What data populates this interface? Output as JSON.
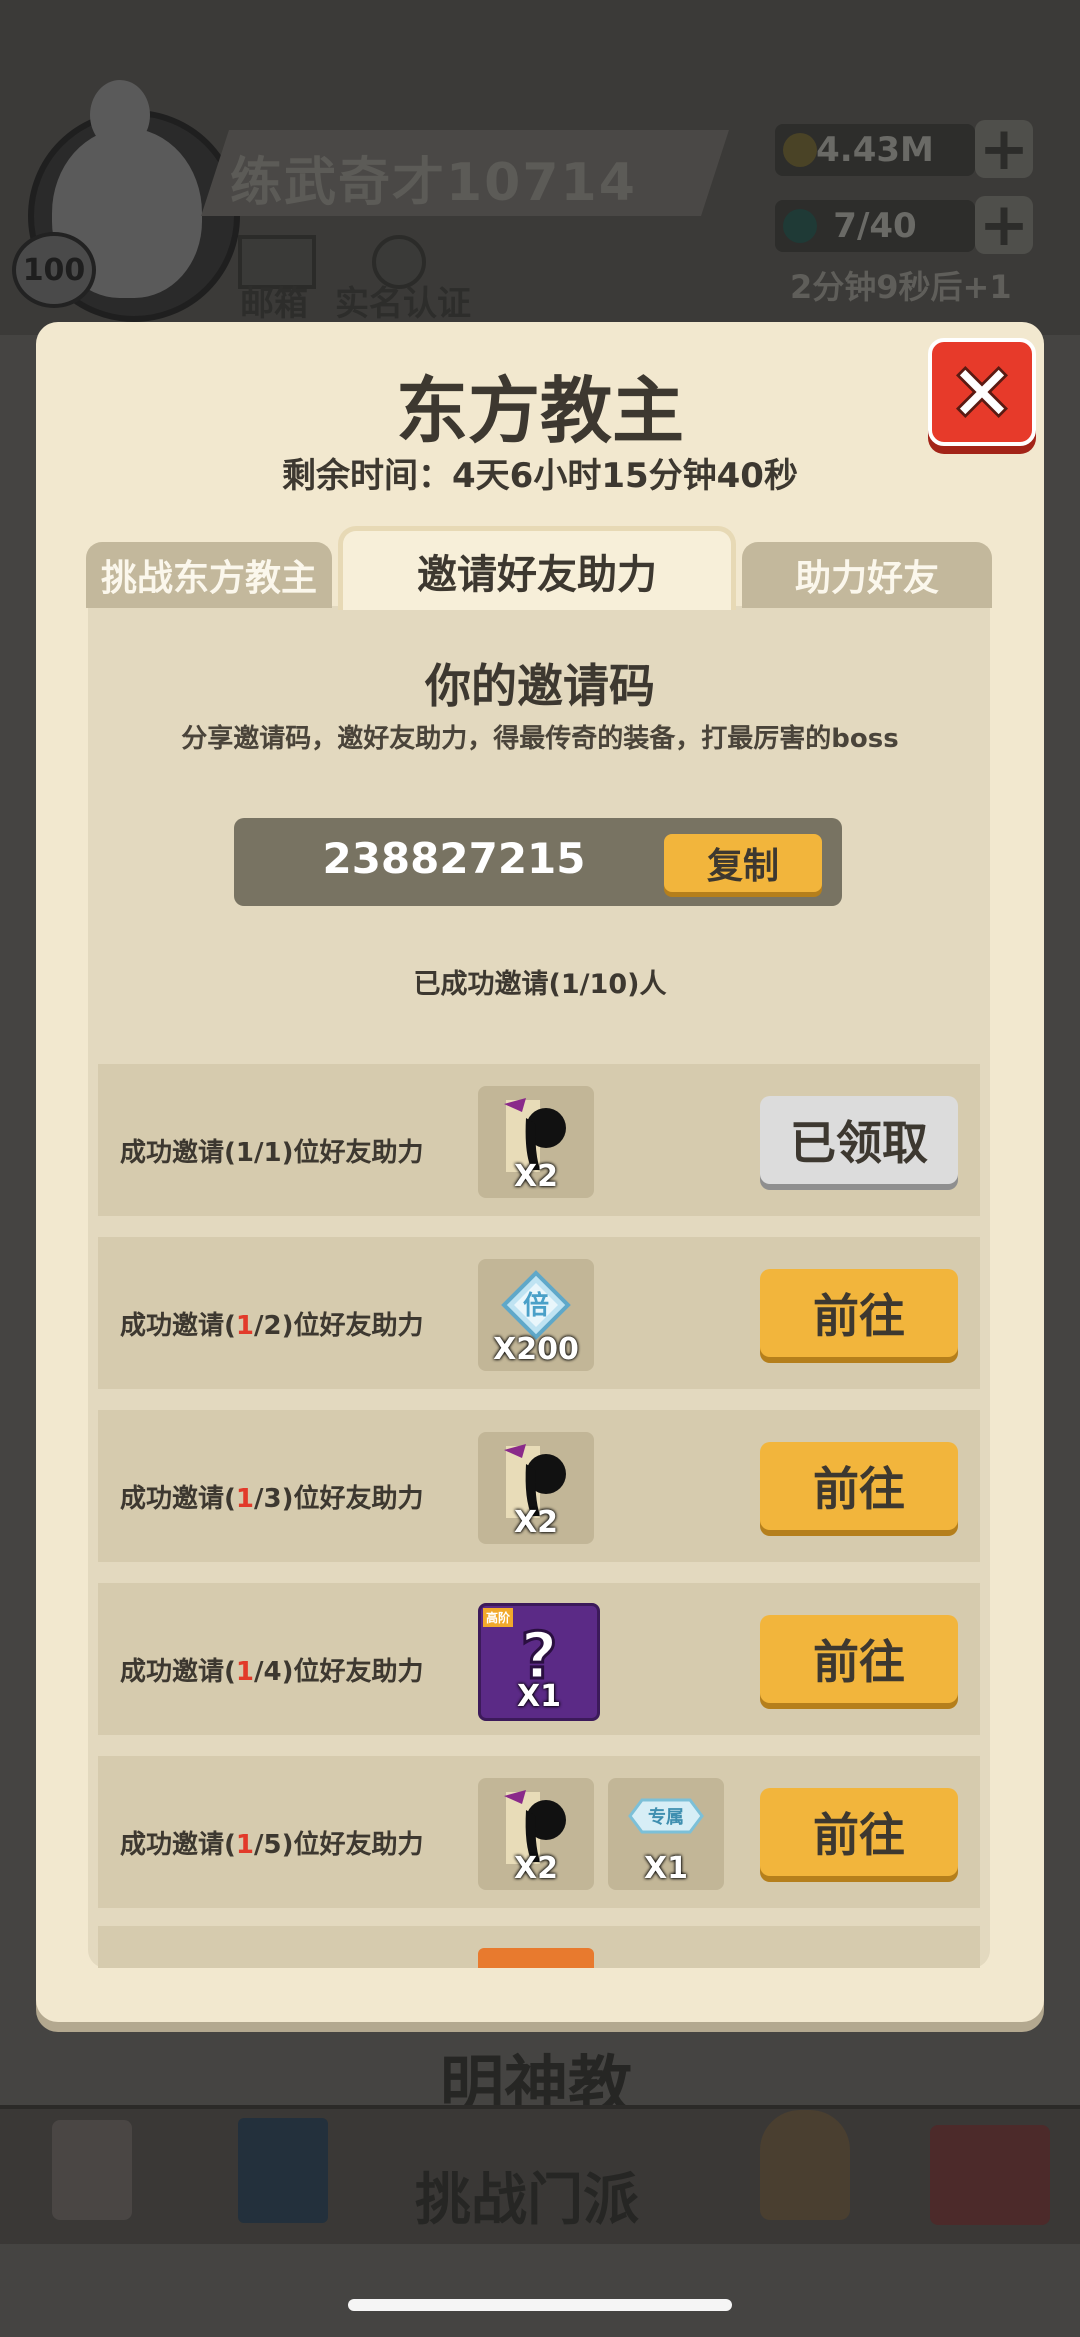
{
  "background": {
    "player_name": "练武奇才10714",
    "level": "100",
    "gold": "4.43M",
    "energy": "7/40",
    "energy_timer": "2分钟9秒后+1",
    "mail_label": "邮箱",
    "realname_label": "实名认证",
    "section_label": "明神教",
    "nav": {
      "main_label": "挑战门派"
    }
  },
  "modal": {
    "title": "东方教主",
    "countdown": "剩余时间：4天6小时15分钟40秒",
    "tabs": [
      {
        "label": "挑战东方教主"
      },
      {
        "label": "邀请好友助力"
      },
      {
        "label": "助力好友"
      }
    ],
    "invite": {
      "heading": "你的邀请码",
      "description": "分享邀请码，邀好友助力，得最传奇的装备，打最厉害的boss",
      "code": "238827215",
      "copy_label": "复制",
      "invited_count": "已成功邀请(1/10)人"
    },
    "rows": [
      {
        "label_prefix": "成功邀请(",
        "progress": "1",
        "label_suffix": "/1)位好友助力",
        "progress_highlight": false,
        "rewards": [
          {
            "icon": "ninja-character-icon",
            "qty": "X2"
          }
        ],
        "button": "已领取",
        "button_state": "claimed"
      },
      {
        "label_prefix": "成功邀请(",
        "progress": "1",
        "label_suffix": "/2)位好友助力",
        "progress_highlight": true,
        "rewards": [
          {
            "icon": "diamond-multiplier-icon",
            "qty": "X200"
          }
        ],
        "button": "前往",
        "button_state": "go"
      },
      {
        "label_prefix": "成功邀请(",
        "progress": "1",
        "label_suffix": "/3)位好友助力",
        "progress_highlight": true,
        "rewards": [
          {
            "icon": "ninja-character-icon",
            "qty": "X2"
          }
        ],
        "button": "前往",
        "button_state": "go"
      },
      {
        "label_prefix": "成功邀请(",
        "progress": "1",
        "label_suffix": "/4)位好友助力",
        "progress_highlight": true,
        "rewards": [
          {
            "icon": "mystery-box-icon",
            "qty": "X1",
            "tag": "高阶"
          }
        ],
        "button": "前往",
        "button_state": "go"
      },
      {
        "label_prefix": "成功邀请(",
        "progress": "1",
        "label_suffix": "/5)位好友助力",
        "progress_highlight": true,
        "rewards": [
          {
            "icon": "ninja-character-icon",
            "qty": "X2"
          },
          {
            "icon": "exclusive-badge-icon",
            "qty": "X1",
            "badge_text": "专属"
          }
        ],
        "button": "前往",
        "button_state": "go"
      }
    ]
  },
  "colors": {
    "modal_bg": "#f2e8cf",
    "panel_bg": "#e3d9bf",
    "row_bg": "#d6cbae",
    "button_go": "#f2b53c",
    "button_claimed": "#dcdcdc",
    "close_red": "#e73a2a",
    "highlight_red": "#e23a2a"
  }
}
